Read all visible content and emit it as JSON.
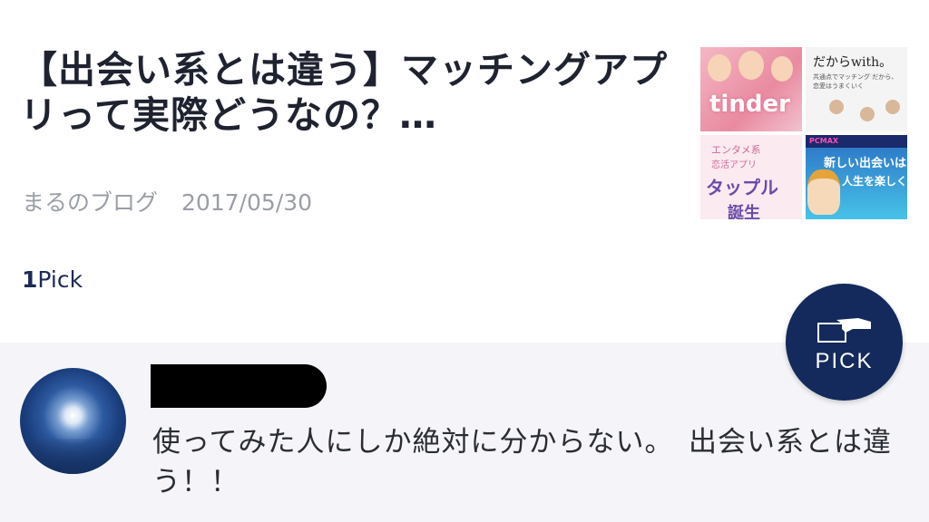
{
  "article": {
    "title": "【出会い系とは違う】マッチングアプリって実際どうなの？…",
    "source": "まるのブログ",
    "date": "2017/05/30",
    "pick_count": "1",
    "pick_suffix": "Pick",
    "thumbnail": {
      "tinder_text": "tinder",
      "with_title": "だからwith。",
      "with_sub": "共通点でマッチング だから、恋愛はうまくいく",
      "tapple_line1": "エンタメ系",
      "tapple_line2": "恋活アプリ",
      "tapple_line3": "タップル",
      "tapple_line4": "誕生",
      "pcmax_header": "PCMAX",
      "pcmax_line1": "新しい出会いは",
      "pcmax_line2": "人生を楽しく"
    }
  },
  "pick_button": {
    "label": "PICK",
    "icon": "card-hand-icon"
  },
  "comment": {
    "text": "使ってみた人にしか絶対に分からない。　出会い系とは違う！！",
    "avatar": "moon-avatar"
  },
  "colors": {
    "title": "#1f2330",
    "meta": "#9a9ea6",
    "brand_navy": "#142a5c",
    "comment_bg": "#f5f5f9"
  }
}
